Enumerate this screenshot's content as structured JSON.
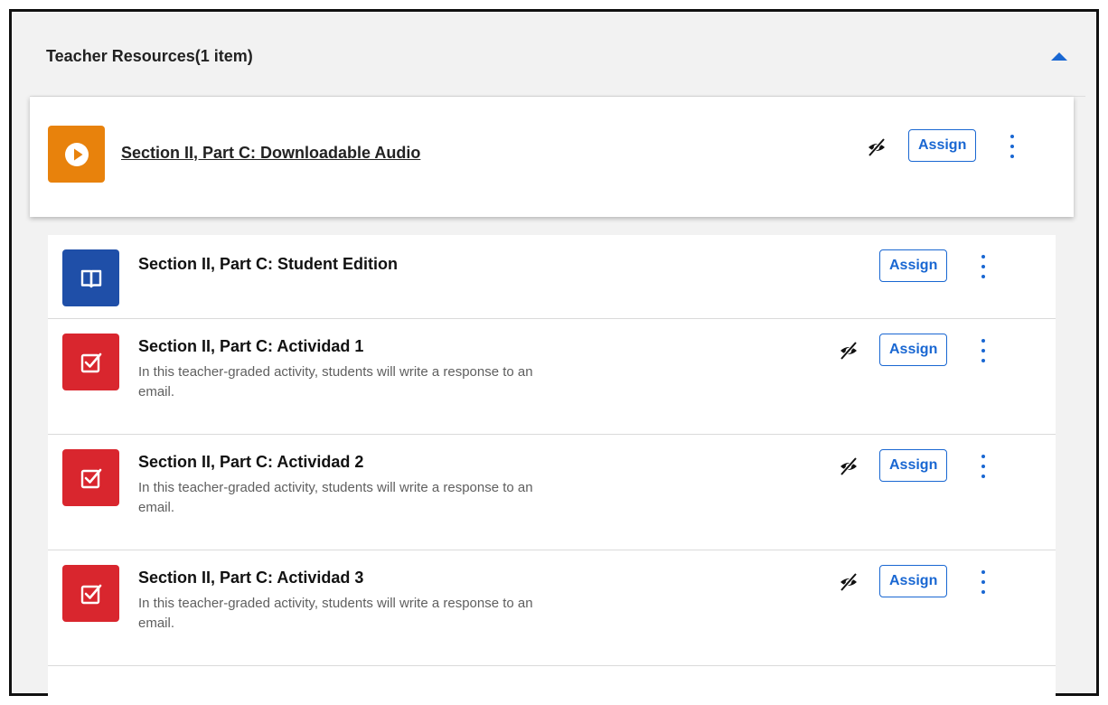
{
  "section": {
    "title": "Teacher Resources(1 item)",
    "collapse_icon": "chevron-up-icon"
  },
  "featured": {
    "title": "Section II, Part C: Downloadable Audio",
    "icon": "play-icon",
    "icon_color": "#e8820c",
    "hidden_icon": "eye-slash-icon",
    "assign_label": "Assign"
  },
  "items": [
    {
      "title": "Section II, Part C: Student Edition",
      "description": "",
      "icon": "book-icon",
      "icon_color": "#1f4fa8",
      "hidden": false,
      "assign_label": "Assign"
    },
    {
      "title": "Section II, Part C: Actividad 1",
      "description": "In this teacher-graded activity, students will write a response to an email.",
      "icon": "checkbox-icon",
      "icon_color": "#d9262e",
      "hidden": true,
      "assign_label": "Assign"
    },
    {
      "title": "Section II, Part C: Actividad 2",
      "description": "In this teacher-graded activity, students will write a response to an email.",
      "icon": "checkbox-icon",
      "icon_color": "#d9262e",
      "hidden": true,
      "assign_label": "Assign"
    },
    {
      "title": "Section II, Part C: Actividad 3",
      "description": "In this teacher-graded activity, students will write a response to an email.",
      "icon": "checkbox-icon",
      "icon_color": "#d9262e",
      "hidden": true,
      "assign_label": "Assign"
    }
  ],
  "colors": {
    "accent": "#1967d2"
  }
}
